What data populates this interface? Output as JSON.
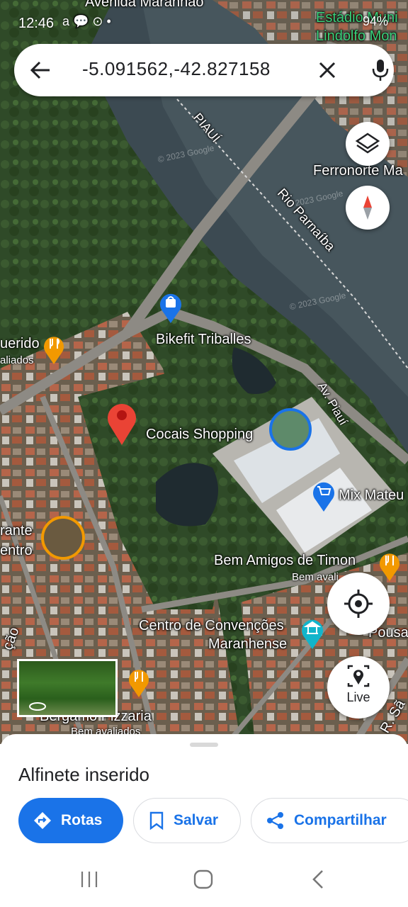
{
  "status_bar": {
    "time": "12:46",
    "icons_left": "a 💬 ⊙ •",
    "battery": "94%"
  },
  "search": {
    "value": "-5.091562,-42.827158"
  },
  "map_labels": {
    "avenida": "Avenida Maranhão",
    "estadio": "Estádio Muni",
    "lindolfo": "Lindolfo Mon",
    "piaui": "PIAUÍ",
    "ferronorte": "Ferronorte Ma",
    "rio": "Rio Parnaíba",
    "bikefit": "Bikefit Triballes",
    "querido": "uerido",
    "querido_sub": "aliados",
    "av_piaui": "Av. Piauí",
    "cocais": "Cocais Shopping",
    "mix": "Mix Mateu",
    "mirante_1": "rante",
    "mirante_2": "entro",
    "bem_amigos": "Bem Amigos de Timon",
    "bem_amigos_sub": "Bem avali",
    "centro_conv_1": "Centro de Convenções",
    "centro_conv_2": "Maranhense",
    "pousa": "Pousa",
    "acao": "ção",
    "bergamo": "Bergamo Pizzaria",
    "bergamo_sub": "Bem avaliados",
    "r_sao": "R. Sã",
    "copyright_1": "© 2023 Google",
    "copyright_2": "© 2023 Google",
    "copyright_3": "© 2023 Google"
  },
  "buttons": {
    "live": "Live"
  },
  "sheet": {
    "title": "Alfinete inserido",
    "rotas": "Rotas",
    "salvar": "Salvar",
    "compartilhar": "Compartilhar"
  },
  "colors": {
    "accent": "#1a73e8",
    "pin": "#ea4335",
    "food_poi": "#f29900",
    "shop_poi": "#1a73e8",
    "landmark_poi": "#12b5cb"
  }
}
